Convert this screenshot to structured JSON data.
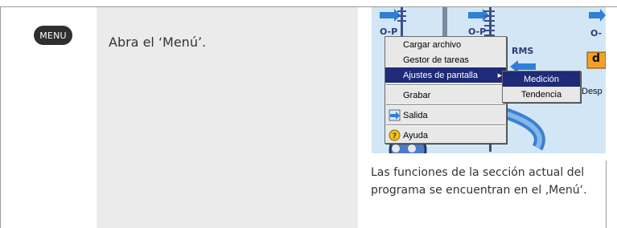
{
  "step": {
    "key_label": "MENU",
    "instruction": "Abra el ‘Menú’."
  },
  "screenshot": {
    "bg_labels": {
      "rms": "RMS",
      "d": "d",
      "desp": "Desp",
      "o_left": "O-P",
      "o_mid": "O-P",
      "o_right": "O-"
    },
    "menu": {
      "items": [
        {
          "label": "Cargar archivo"
        },
        {
          "label": "Gestor de tareas"
        },
        {
          "label": "Ajustes de pantalla",
          "highlighted": true,
          "has_submenu": true
        },
        {
          "label": "Grabar"
        },
        {
          "label": "Salida",
          "icon": "exit-arrow-icon"
        },
        {
          "label": "Ayuda",
          "icon": "help-icon"
        }
      ],
      "submenu_arrow": "▶",
      "submenu": [
        {
          "label": "Medición",
          "highlighted": true
        },
        {
          "label": "Tendencia"
        }
      ]
    }
  },
  "caption": {
    "line1": "Las funciones de la sección actual del",
    "line2": "programa se encuentran en el ‚Menú‘."
  },
  "colors": {
    "accent_blue": "#1f2a78",
    "screen_bg": "#cfe3f3",
    "step_bg": "#ebebeb"
  }
}
